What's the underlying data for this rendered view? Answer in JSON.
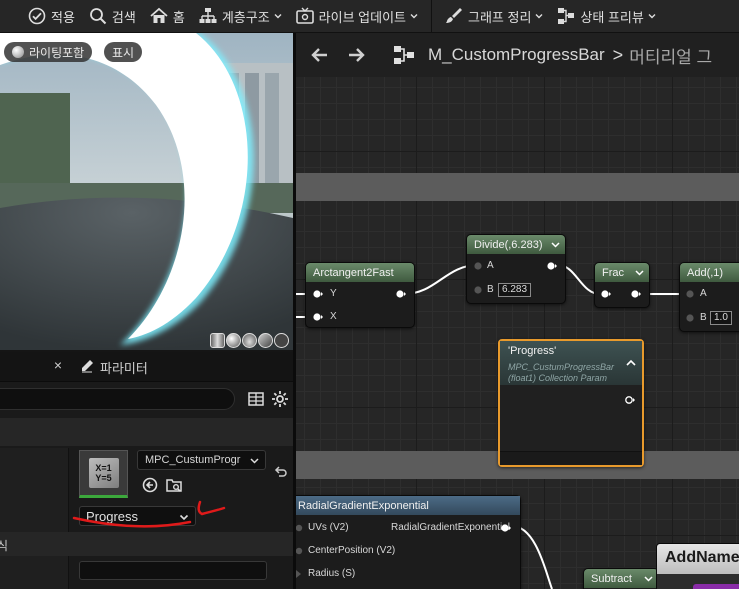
{
  "toolbar": {
    "apply_label": "적용",
    "search_label": "검색",
    "home_label": "홈",
    "hierarchy_label": "계층구조",
    "live_update_label": "라이브 업데이트",
    "clean_graph_label": "그래프 정리",
    "preview_state_label": "상태 프리뷰"
  },
  "viewport": {
    "lit_label": "라이팅포함",
    "show_label": "표시"
  },
  "details": {
    "tab_close": "×",
    "parameter_tab_label": "파라미터",
    "thumb_line1": "X=1",
    "thumb_line2": "Y=5",
    "collection_value": "MPC_CustumProgr",
    "parameter_value": "Progress",
    "section_label": "식"
  },
  "graph": {
    "breadcrumb_title": "M_CustomProgressBar",
    "breadcrumb_sep": ">",
    "breadcrumb_sub": "머티리얼 그",
    "nodes": {
      "arctan": {
        "title": "Arctangent2Fast",
        "pin_y": "Y",
        "pin_x": "X"
      },
      "divide": {
        "title": "Divide(,6.283)",
        "pin_a": "A",
        "pin_b": "B",
        "b_value": "6.283"
      },
      "frac": {
        "title": "Frac"
      },
      "add": {
        "title": "Add(,1)",
        "pin_a": "A",
        "pin_b": "B",
        "b_value": "1.0"
      },
      "progress": {
        "title": "'Progress'",
        "sub1": "MPC_CustumProgressBar",
        "sub2": "(float1) Collection Param"
      },
      "radial": {
        "title": "RadialGradientExponential",
        "in_uvs": "UVs (V2)",
        "in_center": "CenterPosition (V2)",
        "in_radius": "Radius (S)",
        "out": "RadialGradientExponential"
      },
      "subtract": {
        "title": "Subtract"
      },
      "addnamed": {
        "title": "AddName"
      }
    }
  },
  "colors": {
    "accent_selection": "#e89a2c",
    "node_header_green": "#5a7a5a",
    "node_header_blue": "#4c6b86",
    "annotation_red": "#e01a1a"
  }
}
